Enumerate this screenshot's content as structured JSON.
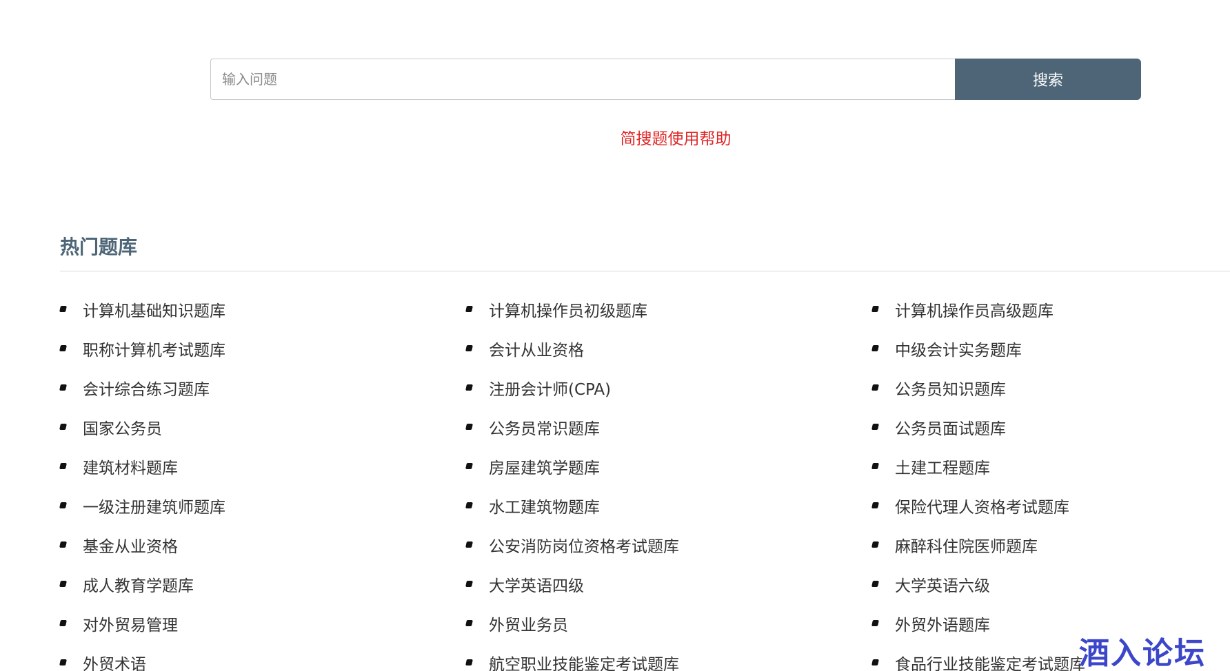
{
  "search": {
    "placeholder": "输入问题",
    "button_label": "搜索"
  },
  "help_link": "简搜题使用帮助",
  "section": {
    "title": "热门题库"
  },
  "banks": [
    "计算机基础知识题库",
    "计算机操作员初级题库",
    "计算机操作员高级题库",
    "职称计算机考试题库",
    "会计从业资格",
    "中级会计实务题库",
    "会计综合练习题库",
    "注册会计师(CPA)",
    "公务员知识题库",
    "国家公务员",
    "公务员常识题库",
    "公务员面试题库",
    "建筑材料题库",
    "房屋建筑学题库",
    "土建工程题库",
    "一级注册建筑师题库",
    "水工建筑物题库",
    "保险代理人资格考试题库",
    "基金从业资格",
    "公安消防岗位资格考试题库",
    "麻醉科住院医师题库",
    "成人教育学题库",
    "大学英语四级",
    "大学英语六级",
    "对外贸易管理",
    "外贸业务员",
    "外贸外语题库",
    "外贸术语",
    "航空职业技能鉴定考试题库",
    "食品行业技能鉴定考试题库"
  ],
  "watermark": "酒入论坛",
  "colors": {
    "accent": "#4d6577",
    "help_link": "#e02424",
    "watermark": "#3b46c9"
  }
}
